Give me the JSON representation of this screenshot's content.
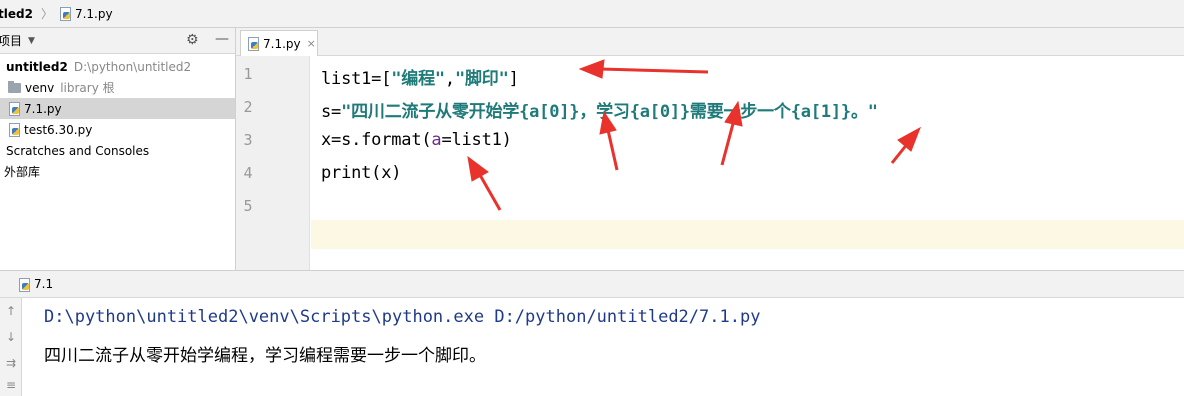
{
  "breadcrumb": {
    "project": "tled2",
    "file": "7.1.py"
  },
  "project_panel": {
    "title": "项目",
    "tree": [
      {
        "label": "untitled2",
        "extra": "D:\\python\\untitled2"
      },
      {
        "label": "venv",
        "extra": "library 根"
      },
      {
        "label": "7.1.py",
        "extra": ""
      },
      {
        "label": "test6.30.py",
        "extra": ""
      },
      {
        "label": "Scratches and Consoles",
        "extra": ""
      },
      {
        "label": "外部库",
        "extra": ""
      }
    ]
  },
  "editor": {
    "tab_label": "7.1.py",
    "line_numbers": [
      "1",
      "2",
      "3",
      "4",
      "5"
    ],
    "lines": {
      "l1": {
        "a": "list1=[",
        "b": "\"编程\"",
        "c": ",",
        "d": "\"脚印\"",
        "e": "]"
      },
      "l2": {
        "a": "s=",
        "b": "\"四川二流子从零开始学{a[0]}，学习{a[0]}需要一步一个{a[1]}。\""
      },
      "l3": {
        "a": "x=s.format(",
        "b": "a",
        "c": "=list1)"
      },
      "l4": {
        "a": "print(x)"
      }
    }
  },
  "run": {
    "tab_label": "7.1",
    "output": [
      "D:\\python\\untitled2\\venv\\Scripts\\python.exe D:/python/untitled2/7.1.py",
      "四川二流子从零开始学编程，学习编程需要一步一个脚印。"
    ]
  },
  "colors": {
    "string": "#1f7a7a",
    "param": "#6a2c8a",
    "arrow": "#e8322b",
    "path_output": "#1f3a8a",
    "current_line": "#fcf8e3"
  }
}
